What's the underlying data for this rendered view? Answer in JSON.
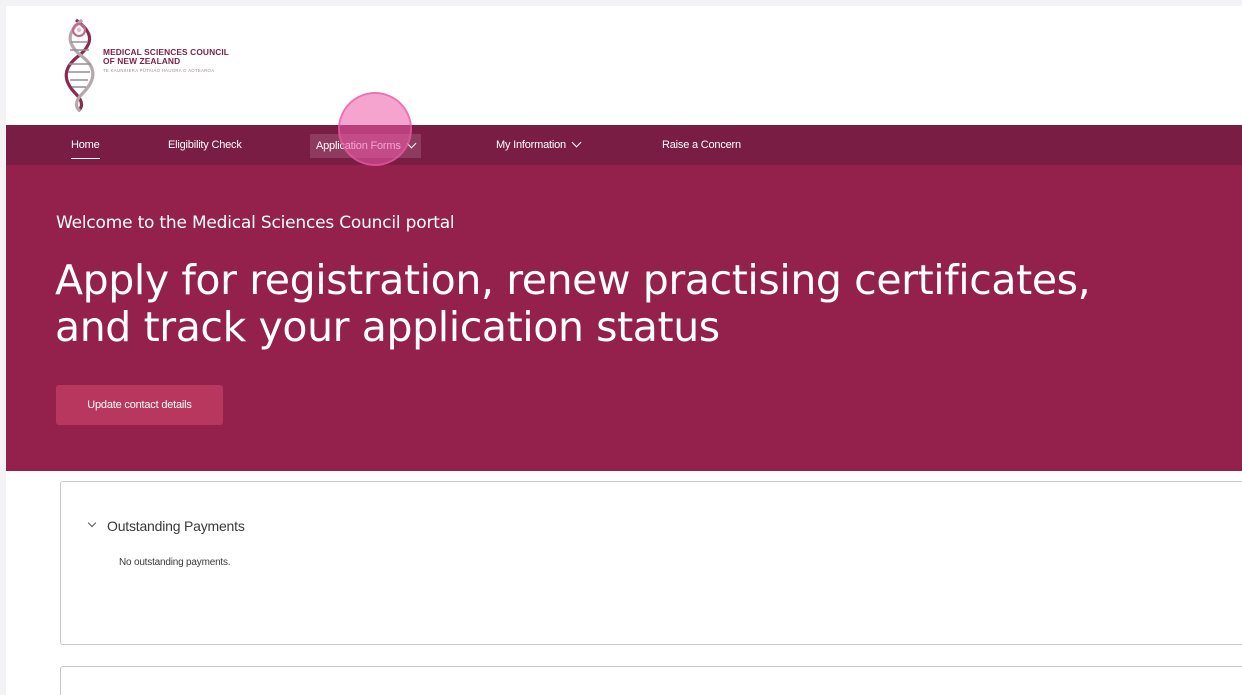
{
  "brand": {
    "name_line1": "MEDICAL SCIENCES COUNCIL",
    "name_line2": "OF NEW ZEALAND",
    "subtitle": "TE KAUNIHERA PŪTAIAO HAUORA O AOTEAROA",
    "color": "#7a1f45"
  },
  "nav": {
    "items": [
      {
        "label": "Home",
        "active": true
      },
      {
        "label": "Eligibility Check"
      },
      {
        "label": "Application Forms",
        "has_dropdown": true
      },
      {
        "label": "My Information",
        "has_dropdown": true
      },
      {
        "label": "Raise a Concern"
      }
    ]
  },
  "hero": {
    "welcome": "Welcome to the Medical Sciences Council portal",
    "title": "Apply for registration, renew practising certificates, and track your application status",
    "button_label": "Update contact details"
  },
  "payments": {
    "title": "Outstanding Payments",
    "message": "No outstanding payments."
  },
  "icons": {
    "chevron": "chevron-down-icon",
    "logo": "dna-helix-icon"
  },
  "colors": {
    "nav_bg": "#7a1d45",
    "hero_bg": "#94214c",
    "button_bg": "#b8375f",
    "active_nav_bg": "#8e3b5f"
  }
}
